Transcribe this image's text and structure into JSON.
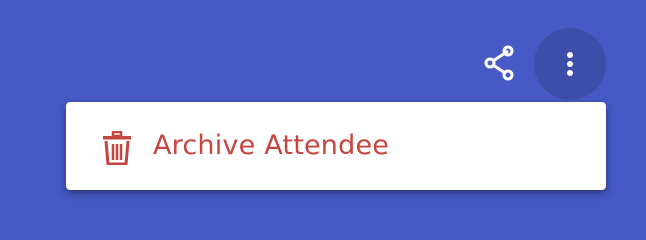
{
  "toolbar": {
    "share_icon": "share-icon",
    "more_icon": "more-vert-icon"
  },
  "menu": {
    "items": [
      {
        "label": "Archive Attendee",
        "icon": "trash-icon",
        "color": "#c64540"
      }
    ]
  },
  "colors": {
    "background": "#4659c4",
    "active_button_bg": "#3d4ea8",
    "danger": "#c64540"
  }
}
